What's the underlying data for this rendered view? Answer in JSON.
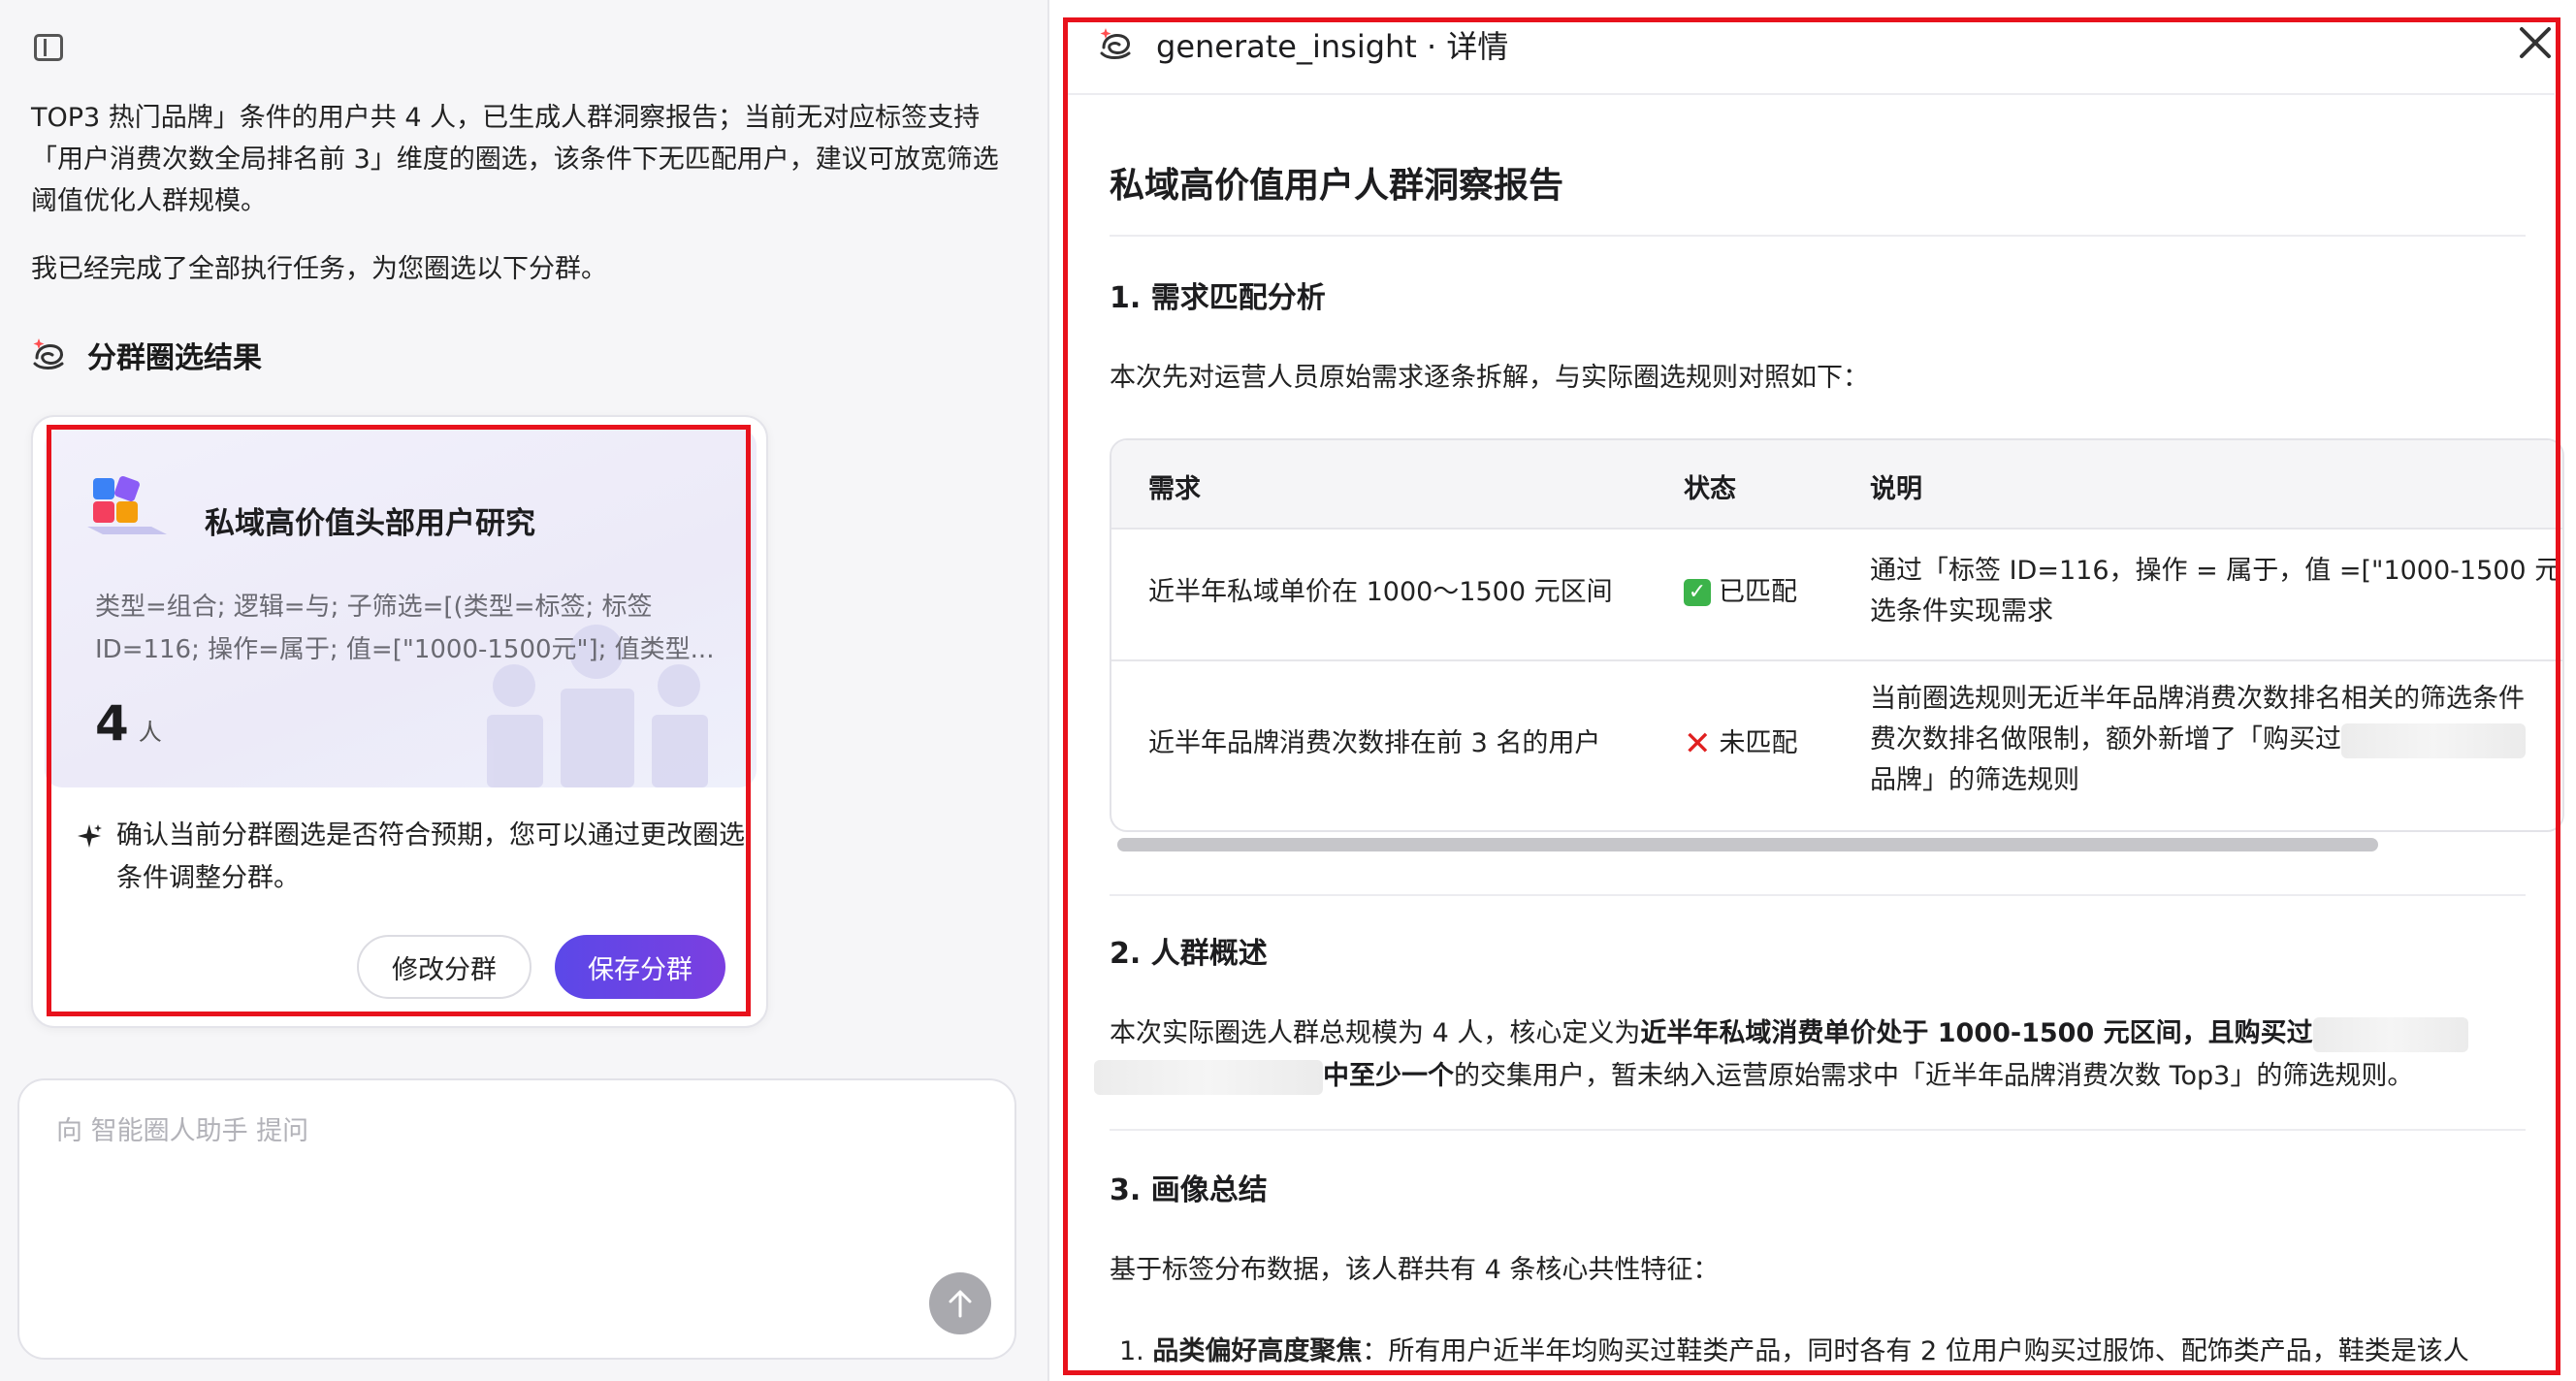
{
  "chat": {
    "paragraph1": "TOP3 热门品牌」条件的用户共 4 人，已生成人群洞察报告；当前无对应标签支持「用户消费次数全局排名前 3」维度的圈选，该条件下无匹配用户，建议可放宽筛选阈值优化人群规模。",
    "paragraph2": "我已经完成了全部执行任务，为您圈选以下分群。",
    "section_title": "分群圈选结果"
  },
  "segment_card": {
    "title": "私域高价值头部用户研究",
    "description": "类型=组合; 逻辑=与; 子筛选=[(类型=标签; 标签ID=116; 操作=属于; 值=[\"1000-1500元\"]; 值类型...",
    "count": "4",
    "unit": "人",
    "confirm_text": "确认当前分群圈选是否符合预期，您可以通过更改圈选条件调整分群。",
    "edit_label": "修改分群",
    "save_label": "保存分群"
  },
  "input": {
    "placeholder": "向 智能圈人助手 提问"
  },
  "detail": {
    "header_title": "generate_insight · 详情",
    "report_title": "私域高价值用户人群洞察报告",
    "section1": {
      "heading": "1. 需求匹配分析",
      "intro": "本次先对运营人员原始需求逐条拆解，与实际圈选规则对照如下：",
      "columns": [
        "需求",
        "状态",
        "说明"
      ],
      "rows": [
        {
          "need": "近半年私域单价在 1000～1500 元区间",
          "status": "已匹配",
          "desc_line1": "通过「标签 ID=116，操作 = 属于，值 =[\"1000-1500 元",
          "desc_line2": "选条件实现需求"
        },
        {
          "need": "近半年品牌消费次数排在前 3 名的用户",
          "status": "未匹配",
          "desc_line1": "当前圈选规则无近半年品牌消费次数排名相关的筛选条件",
          "desc_line2": "费次数排名做限制，额外新增了「购买过",
          "desc_line3": "品牌」的筛选规则"
        }
      ]
    },
    "section2": {
      "heading": "2. 人群概述",
      "text_a": "本次实际圈选人群总规模为 4 人，核心定义为",
      "text_bold": "近半年私域消费单价处于 1000-1500 元区间，且购买过",
      "text_bold2": "中至少一个",
      "text_c": "的交集用户，暂未纳入运营原始需求中「近半年品牌消费次数 Top3」的筛选规则。"
    },
    "section3": {
      "heading": "3. 画像总结",
      "intro": "基于标签分布数据，该人群共有 4 条核心共性特征：",
      "item1_bold": "品类偏好高度聚焦",
      "item1_text": "：所有用户近半年均购买过鞋类产品，同时各有 2 位用户购买过服饰、配饰类产品，鞋类是该人",
      "item1_num": "1."
    }
  },
  "colors": {
    "accent": "#5b48e8",
    "highlight_border": "#e8121c",
    "match_green": "#3cb34a",
    "mismatch_red": "#e02020"
  }
}
